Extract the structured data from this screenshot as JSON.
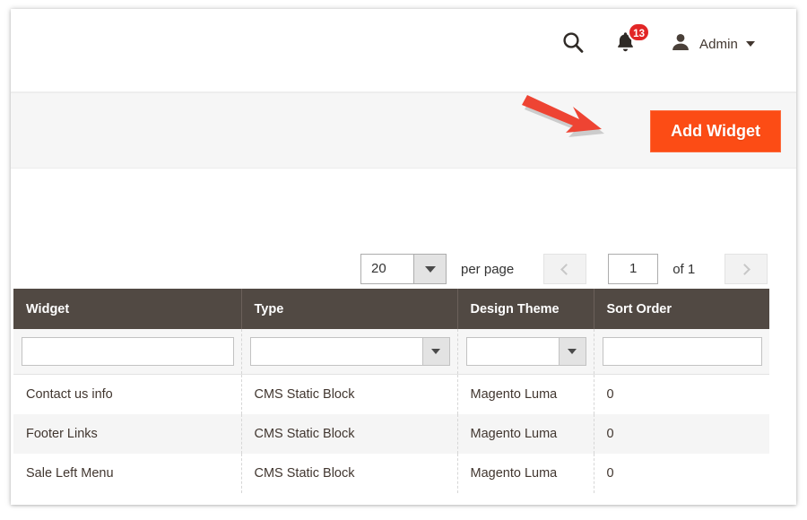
{
  "admin_bar": {
    "search_icon": "search-icon",
    "notifications": {
      "icon": "bell-icon",
      "count": "13",
      "badge_color": "#e22626"
    },
    "user": {
      "avatar_icon": "user-avatar-icon",
      "label": "Admin",
      "caret_icon": "chevron-down-icon"
    }
  },
  "toolbar": {
    "add_widget_label": "Add Widget",
    "button_color": "#fc4c15",
    "annotation_arrow": {
      "name": "red-callout-arrow",
      "color": "#ee4433",
      "points_to": "Add Widget"
    }
  },
  "pagination": {
    "per_page_value": "20",
    "per_page_label": "per page",
    "prev_icon": "chevron-left-icon",
    "next_icon": "chevron-right-icon",
    "current_page": "1",
    "of_label": "of 1"
  },
  "grid": {
    "header_color": "#514943",
    "columns": [
      {
        "label": "Widget",
        "filter_type": "text",
        "filter_value": ""
      },
      {
        "label": "Type",
        "filter_type": "select",
        "filter_value": ""
      },
      {
        "label": "Design Theme",
        "filter_type": "select",
        "filter_value": ""
      },
      {
        "label": "Sort Order",
        "filter_type": "text",
        "filter_value": ""
      }
    ],
    "rows": [
      {
        "widget": "Contact us info",
        "type": "CMS Static Block",
        "design_theme": "Magento Luma",
        "sort_order": "0"
      },
      {
        "widget": "Footer Links",
        "type": "CMS Static Block",
        "design_theme": "Magento Luma",
        "sort_order": "0"
      },
      {
        "widget": "Sale Left Menu",
        "type": "CMS Static Block",
        "design_theme": "Magento Luma",
        "sort_order": "0"
      }
    ]
  }
}
